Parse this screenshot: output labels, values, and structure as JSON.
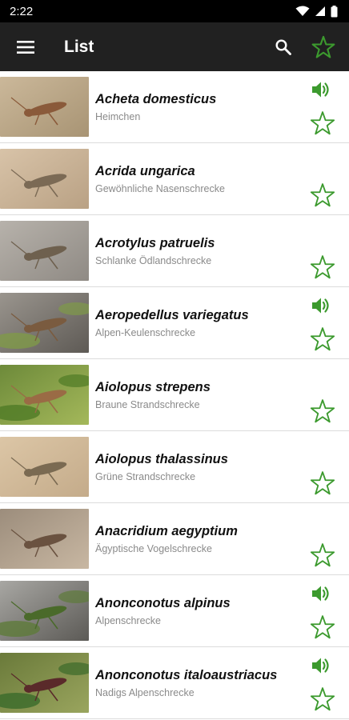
{
  "status_bar": {
    "time": "2:22"
  },
  "app_bar": {
    "title": "List",
    "icons": {
      "menu": "hamburger-menu-icon",
      "search": "search-icon",
      "favorites": "star-outline-icon"
    }
  },
  "colors": {
    "app_bar": "#212121",
    "accent_green": "#3c9a2e",
    "scientific_name": "#111111",
    "common_name": "#8a8a8a",
    "divider": "#dcdcdc"
  },
  "species": [
    {
      "scientific": "Acheta domesticus",
      "common": "Heimchen",
      "has_sound": true
    },
    {
      "scientific": "Acrida ungarica",
      "common": "Gewöhnliche Nasenschrecke",
      "has_sound": false
    },
    {
      "scientific": "Acrotylus patruelis",
      "common": "Schlanke Ödlandschrecke",
      "has_sound": false
    },
    {
      "scientific": "Aeropedellus variegatus",
      "common": "Alpen-Keulenschrecke",
      "has_sound": true
    },
    {
      "scientific": "Aiolopus strepens",
      "common": "Braune Strandschrecke",
      "has_sound": false
    },
    {
      "scientific": "Aiolopus thalassinus",
      "common": "Grüne Strandschrecke",
      "has_sound": false
    },
    {
      "scientific": "Anacridium aegyptium",
      "common": "Ägyptische Vogelschrecke",
      "has_sound": false
    },
    {
      "scientific": "Anonconotus alpinus",
      "common": "Alpenschrecke",
      "has_sound": true
    },
    {
      "scientific": "Anonconotus italoaustriacus",
      "common": "Nadigs Alpenschrecke",
      "has_sound": true
    }
  ]
}
